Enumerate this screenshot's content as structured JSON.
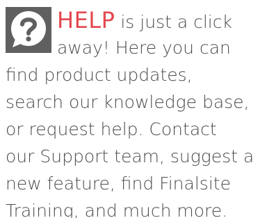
{
  "help_block": {
    "icon": "help-question-icon",
    "accent_color": "#e4474f",
    "help_word": "HELP",
    "line1_rest": " is just a click",
    "line2": "away! Here you can",
    "line3": "find product updates,",
    "line4": "search our knowledge base,",
    "line5": "or request help. Contact",
    "line6": "our Support team, suggest a",
    "line7": "new feature, find Finalsite",
    "line8": "Training, and much more."
  }
}
